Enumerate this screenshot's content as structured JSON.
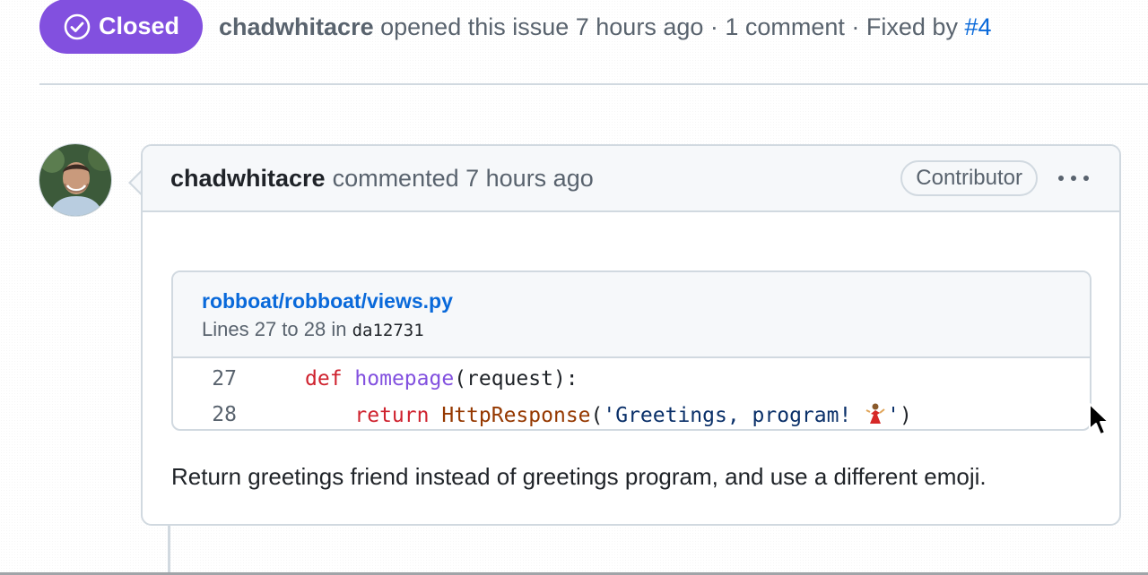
{
  "issue": {
    "state_label": "Closed",
    "author": "chadwhitacre",
    "opened_text": "opened this issue 7 hours ago · 1 comment · Fixed by",
    "fixed_by": "#4"
  },
  "comment": {
    "author": "chadwhitacre",
    "action_text": "commented 7 hours ago",
    "role_badge": "Contributor",
    "body": "Return greetings friend instead of greetings program, and use a different emoji."
  },
  "snippet": {
    "path": "robboat/robboat/views.py",
    "lines_prefix": "Lines 27 to 28 in",
    "commit": "da12731",
    "lines": [
      {
        "number": "27",
        "keyword": "def",
        "name": "homepage",
        "rest": "(request):"
      },
      {
        "number": "28",
        "keyword": "return",
        "name": "HttpResponse",
        "open": "(",
        "string_open": "'Greetings, program! ",
        "string_close": "'",
        "close": ")"
      }
    ]
  },
  "colors": {
    "closed_badge": "#8250df",
    "link": "#0969da",
    "keyword": "#cf222e",
    "function": "#8250df",
    "string": "#0a3069",
    "border": "#d1d9e0"
  },
  "icons": {
    "state": "check-circle-icon",
    "menu": "kebab-horizontal-icon",
    "emoji": "dancer-emoji",
    "cursor": "mouse-cursor-icon"
  }
}
